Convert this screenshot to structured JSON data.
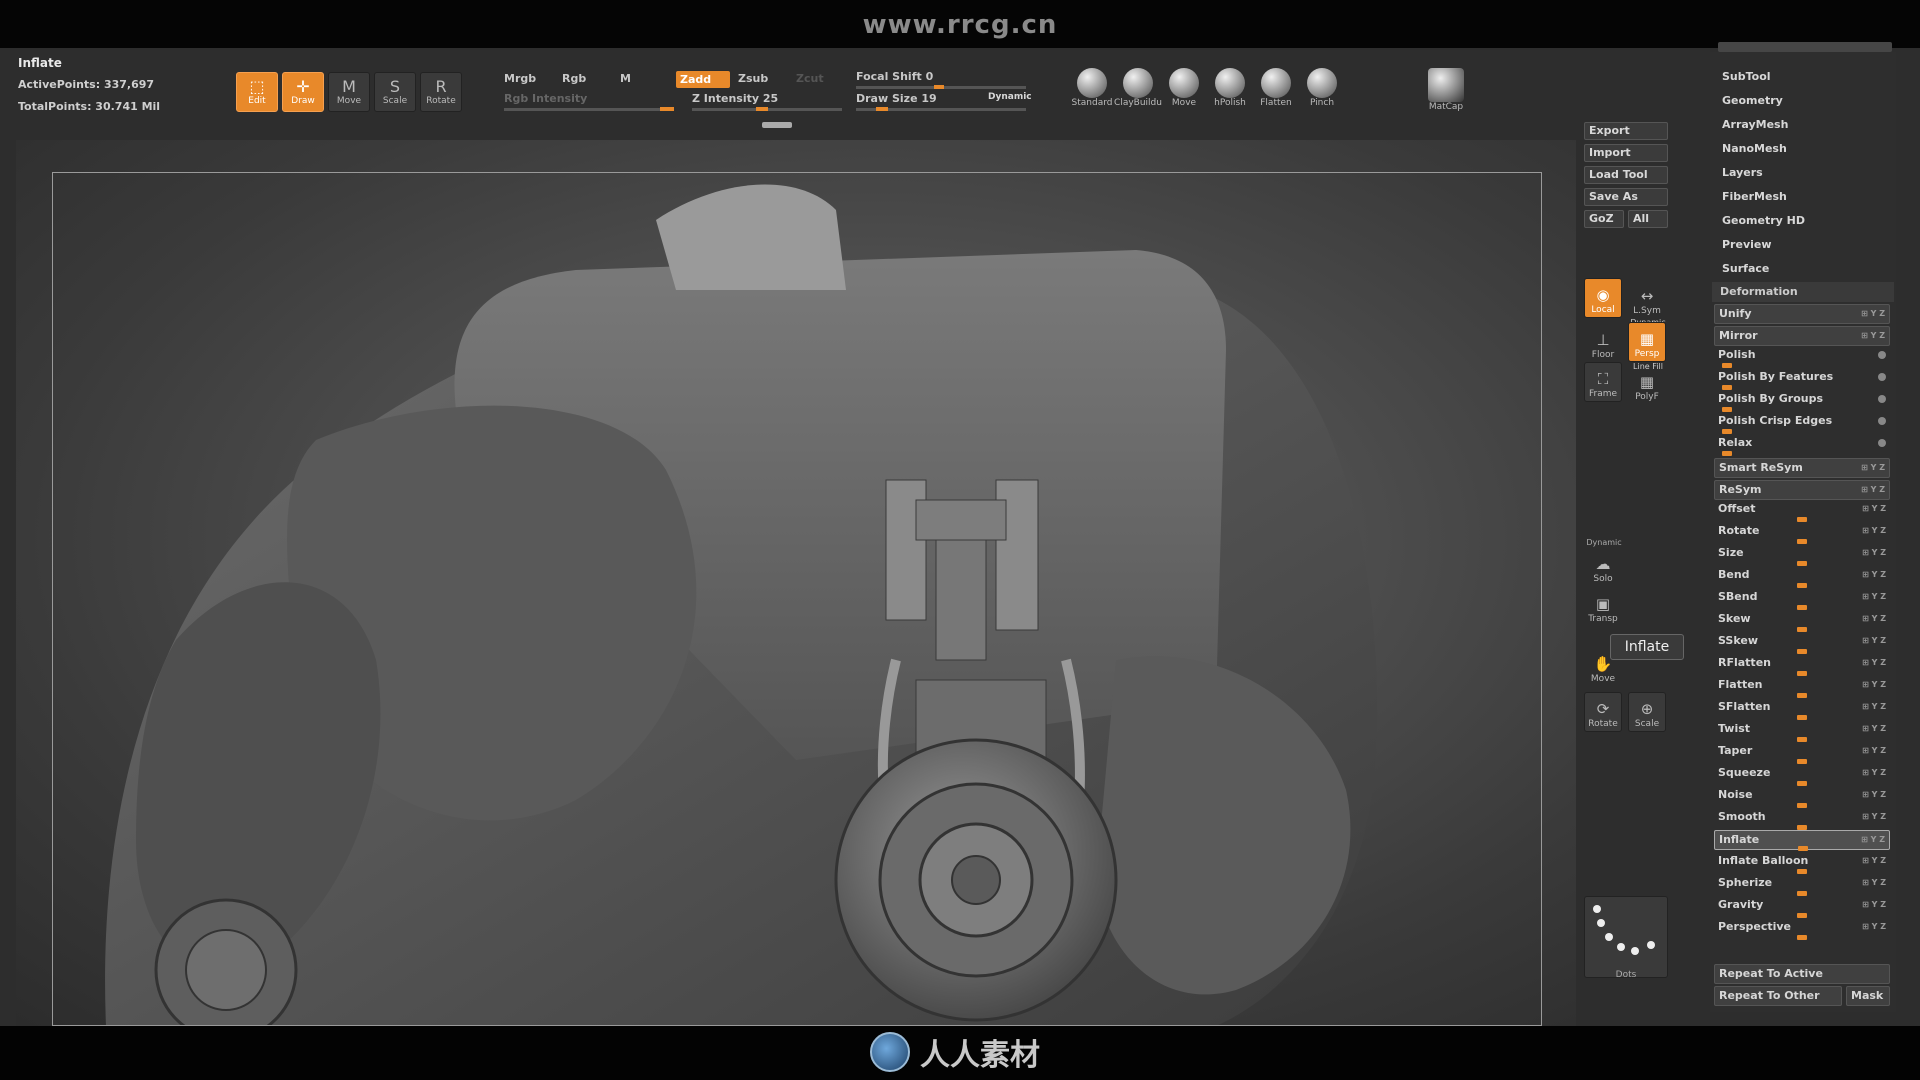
{
  "site_url": "www.rrcg.cn",
  "bottom_logo_text": "人人素材",
  "info": {
    "title": "Inflate",
    "active_points": "ActivePoints: 337,697",
    "total_points": "TotalPoints: 30.741  Mil"
  },
  "modes": [
    {
      "label": "Edit",
      "icon": "edit-icon",
      "glyph": "⬚",
      "active": true
    },
    {
      "label": "Draw",
      "icon": "draw-icon",
      "glyph": "✛",
      "active": true
    },
    {
      "label": "Move",
      "icon": "move-icon",
      "glyph": "M",
      "active": false
    },
    {
      "label": "Scale",
      "icon": "scale-icon",
      "glyph": "S",
      "active": false
    },
    {
      "label": "Rotate",
      "icon": "rotate-icon",
      "glyph": "R",
      "active": false
    }
  ],
  "color_controls": {
    "mrgb": "Mrgb",
    "rgb": "Rgb",
    "m": "M",
    "rgb_intensity": "Rgb Intensity",
    "zadd": "Zadd",
    "zsub": "Zsub",
    "zcut": "Zcut",
    "z_intensity": "Z Intensity 25",
    "focal_shift": "Focal Shift 0",
    "draw_size": "Draw Size 19",
    "dynamic": "Dynamic"
  },
  "brushes": [
    {
      "label": "Standard"
    },
    {
      "label": "ClayBuildu"
    },
    {
      "label": "Move"
    },
    {
      "label": "hPolish"
    },
    {
      "label": "Flatten"
    },
    {
      "label": "Pinch"
    }
  ],
  "matcap_label": "MatCap",
  "file_buttons": {
    "export": "Export",
    "import": "Import",
    "load_tool": "Load Tool",
    "save_as": "Save As",
    "goz": "GoZ",
    "all": "All"
  },
  "shelf": {
    "local": "Local",
    "lsym": "L.Sym",
    "floor": "Floor",
    "persp_top": "Dynamic",
    "persp": "Persp",
    "frame": "Frame",
    "polyf_top": "Line Fill",
    "polyf": "PolyF",
    "solo_top": "Dynamic",
    "solo": "Solo",
    "transp": "Transp",
    "move": "Move",
    "rotate": "Rotate",
    "scale": "Scale"
  },
  "tooltip": "Inflate",
  "dots_label": "Dots",
  "palette_top": [
    "SubTool",
    "Geometry",
    "ArrayMesh",
    "NanoMesh",
    "Layers",
    "FiberMesh",
    "Geometry HD",
    "Preview",
    "Surface"
  ],
  "deformation": {
    "header": "Deformation",
    "rows": [
      {
        "label": "Unify",
        "style": "boxed",
        "icons": "⊞ Y Z",
        "slider": null
      },
      {
        "label": "Mirror",
        "style": "boxed",
        "icons": "⊞ Y Z",
        "slider": null
      },
      {
        "label": "Polish",
        "style": "plain",
        "icons": "",
        "slider": 0.05,
        "circle": true
      },
      {
        "label": "Polish By Features",
        "style": "plain",
        "icons": "",
        "slider": 0.05,
        "circle": true
      },
      {
        "label": "Polish By Groups",
        "style": "plain",
        "icons": "",
        "slider": 0.05,
        "circle": true
      },
      {
        "label": "Polish Crisp Edges",
        "style": "plain",
        "icons": "",
        "slider": 0.05,
        "circle": true
      },
      {
        "label": "Relax",
        "style": "plain",
        "icons": "",
        "slider": 0.05,
        "circle": true
      },
      {
        "label": "Smart ReSym",
        "style": "boxed",
        "icons": "⊞ Y Z",
        "slider": null
      },
      {
        "label": "ReSym",
        "style": "boxed",
        "icons": "⊞ Y Z",
        "slider": null
      },
      {
        "label": "Offset",
        "style": "plain",
        "icons": "⊞ Y Z",
        "slider": 0.5
      },
      {
        "label": "Rotate",
        "style": "plain",
        "icons": "⊞ Y Z",
        "slider": 0.5
      },
      {
        "label": "Size",
        "style": "plain",
        "icons": "⊞ Y Z",
        "slider": 0.5
      },
      {
        "label": "Bend",
        "style": "plain",
        "icons": "⊞ Y Z",
        "slider": 0.5
      },
      {
        "label": "SBend",
        "style": "plain",
        "icons": "⊞ Y Z",
        "slider": 0.5
      },
      {
        "label": "Skew",
        "style": "plain",
        "icons": "⊞ Y Z",
        "slider": 0.5
      },
      {
        "label": "SSkew",
        "style": "plain",
        "icons": "⊞ Y Z",
        "slider": 0.5
      },
      {
        "label": "RFlatten",
        "style": "plain",
        "icons": "⊞ Y Z",
        "slider": 0.5
      },
      {
        "label": "Flatten",
        "style": "plain",
        "icons": "⊞ Y Z",
        "slider": 0.5
      },
      {
        "label": "SFlatten",
        "style": "plain",
        "icons": "⊞ Y Z",
        "slider": 0.5
      },
      {
        "label": "Twist",
        "style": "plain",
        "icons": "⊞ Y Z",
        "slider": 0.5
      },
      {
        "label": "Taper",
        "style": "plain",
        "icons": "⊞ Y Z",
        "slider": 0.5
      },
      {
        "label": "Squeeze",
        "style": "plain",
        "icons": "⊞ Y Z",
        "slider": 0.5
      },
      {
        "label": "Noise",
        "style": "plain",
        "icons": "⊞ Y Z",
        "slider": 0.5
      },
      {
        "label": "Smooth",
        "style": "plain",
        "icons": "⊞ Y Z",
        "slider": 0.5
      },
      {
        "label": "Inflate",
        "style": "selected",
        "icons": "⊞ Y Z",
        "slider": 0.5
      },
      {
        "label": "Inflate Balloon",
        "style": "plain",
        "icons": "⊞ Y Z",
        "slider": 0.5
      },
      {
        "label": "Spherize",
        "style": "plain",
        "icons": "⊞ Y Z",
        "slider": 0.5
      },
      {
        "label": "Gravity",
        "style": "plain",
        "icons": "⊞ Y Z",
        "slider": 0.5
      },
      {
        "label": "Perspective",
        "style": "plain",
        "icons": "⊞ Y Z",
        "slider": 0.5
      }
    ],
    "repeat_to_active": "Repeat To Active",
    "repeat_to_other": "Repeat To Other",
    "mask": "Mask"
  },
  "colors": {
    "accent": "#e8892a",
    "panel": "#2d2d2d",
    "button": "#3a3a3a"
  }
}
